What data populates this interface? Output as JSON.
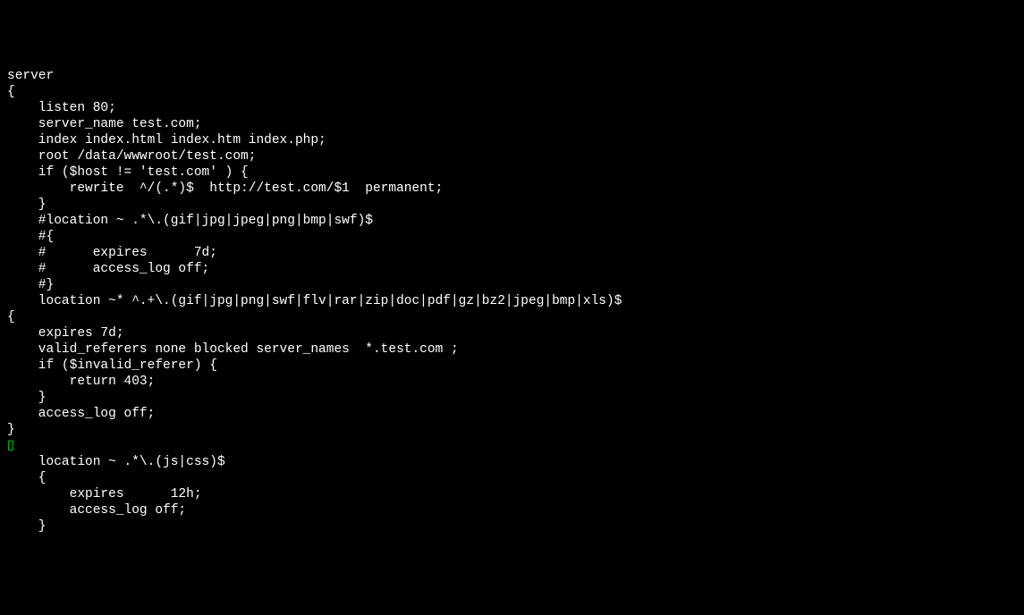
{
  "terminal": {
    "lines": [
      "server",
      "{",
      "    listen 80;",
      "    server_name test.com;",
      "    index index.html index.htm index.php;",
      "    root /data/wwwroot/test.com;",
      "    if ($host != 'test.com' ) {",
      "        rewrite  ^/(.*)$  http://test.com/$1  permanent;",
      "    }",
      "    #location ~ .*\\.(gif|jpg|jpeg|png|bmp|swf)$",
      "    #{",
      "    #      expires      7d;",
      "    #      access_log off;",
      "    #}",
      "    location ~* ^.+\\.(gif|jpg|png|swf|flv|rar|zip|doc|pdf|gz|bz2|jpeg|bmp|xls)$",
      "{",
      "    expires 7d;",
      "    valid_referers none blocked server_names  *.test.com ;",
      "    if ($invalid_referer) {",
      "        return 403;",
      "    }",
      "    access_log off;",
      "}"
    ],
    "cursor_line": "▯",
    "lines_after": [
      "",
      "    location ~ .*\\.(js|css)$",
      "    {",
      "        expires      12h;",
      "        access_log off;",
      "    }"
    ]
  }
}
